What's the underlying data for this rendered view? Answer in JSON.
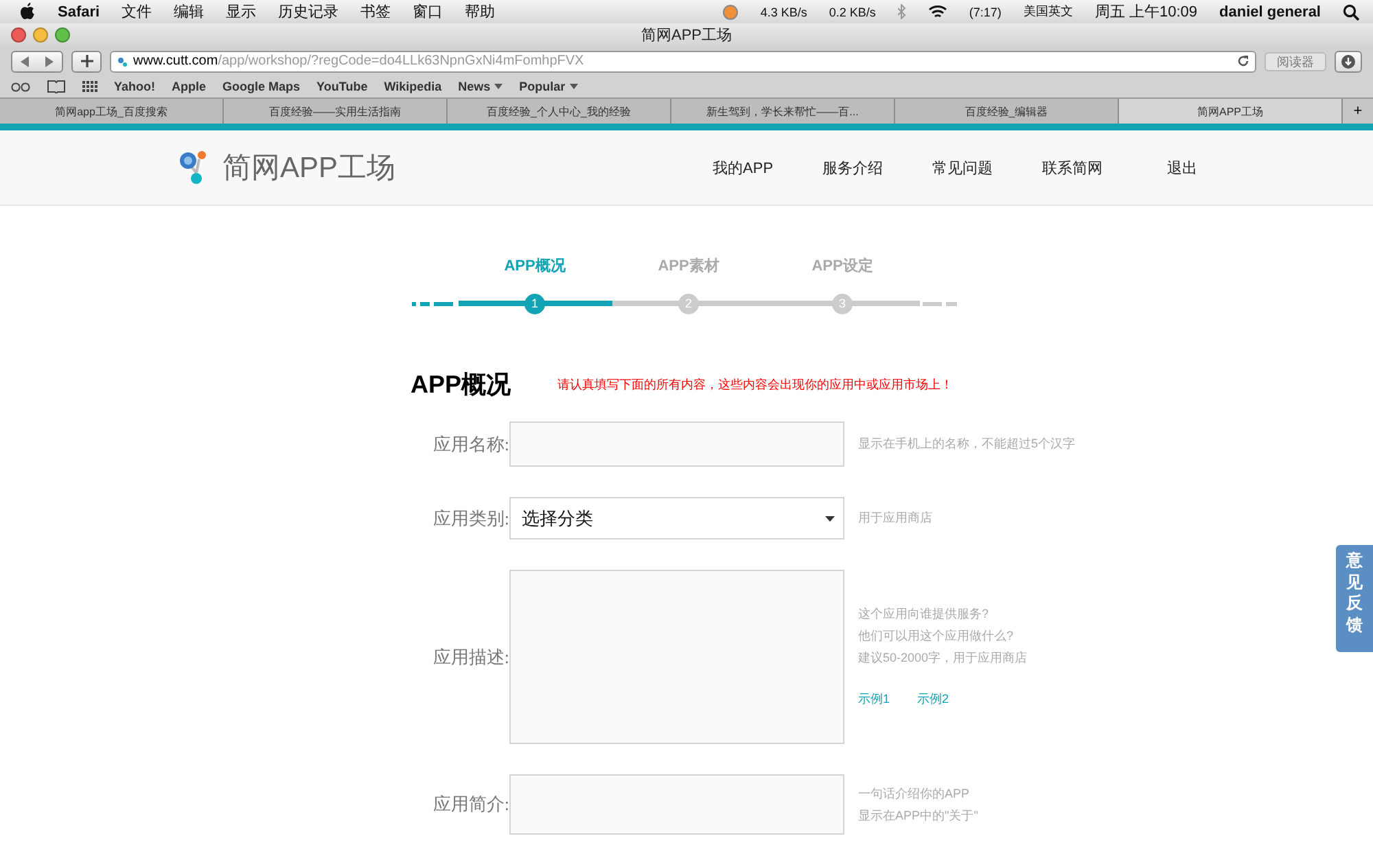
{
  "menubar": {
    "app_name": "Safari",
    "menus": [
      "文件",
      "编辑",
      "显示",
      "历史记录",
      "书签",
      "窗口",
      "帮助"
    ],
    "net_down": "4.3 KB/s",
    "net_up": "0.2 KB/s",
    "battery": "(7:17)",
    "input_source": "美国英文",
    "clock": "周五 上午10:09",
    "user": "daniel general"
  },
  "window": {
    "title": "简网APP工场"
  },
  "address": {
    "domain": "www.cutt.com",
    "path": "/app/workshop/?regCode=do4LLk63NpnGxNi4mFomhpFVX"
  },
  "reader_button": "阅读器",
  "bookmarks": [
    {
      "label": "Yahoo!",
      "kind": "link"
    },
    {
      "label": "Apple",
      "kind": "link"
    },
    {
      "label": "Google Maps",
      "kind": "link"
    },
    {
      "label": "YouTube",
      "kind": "link"
    },
    {
      "label": "Wikipedia",
      "kind": "link"
    },
    {
      "label": "News",
      "kind": "menu"
    },
    {
      "label": "Popular",
      "kind": "menu"
    }
  ],
  "tabs": [
    {
      "label": "简网app工场_百度搜索",
      "selected": false
    },
    {
      "label": "百度经验——实用生活指南",
      "selected": false
    },
    {
      "label": "百度经验_个人中心_我的经验",
      "selected": false
    },
    {
      "label": "新生驾到，学长来帮忙——百...",
      "selected": false
    },
    {
      "label": "百度经验_编辑器",
      "selected": false
    },
    {
      "label": "简网APP工场",
      "selected": true
    }
  ],
  "new_tab": "+",
  "site": {
    "logo": "简网APP工场",
    "nav": [
      "我的APP",
      "服务介绍",
      "常见问题",
      "联系简网",
      "退出"
    ]
  },
  "steps": [
    {
      "label": "APP概况",
      "number": "1",
      "selected": true
    },
    {
      "label": "APP素材",
      "number": "2",
      "selected": false
    },
    {
      "label": "APP设定",
      "number": "3",
      "selected": false
    }
  ],
  "form": {
    "title": "APP概况",
    "notice": "请认真填写下面的所有内容，这些内容会出现你的应用中或应用市场上！",
    "fields": [
      {
        "label": "应用名称:",
        "kind": "input",
        "hints": [
          "显示在手机上的名称，不能超过5个汉字"
        ]
      },
      {
        "label": "应用类别:",
        "kind": "select",
        "value": "选择分类",
        "hints": [
          "用于应用商店"
        ]
      },
      {
        "label": "应用描述:",
        "kind": "textarea",
        "hints": [
          "这个应用向谁提供服务?",
          "他们可以用这个应用做什么?",
          "建议50-2000字，用于应用商店"
        ],
        "links": [
          "示例1",
          "示例2"
        ]
      },
      {
        "label": "应用简介:",
        "kind": "short_textarea",
        "hints": [
          "一句话介绍你的APP",
          "显示在APP中的\"关于\""
        ]
      }
    ]
  },
  "feedback": "意见反馈"
}
